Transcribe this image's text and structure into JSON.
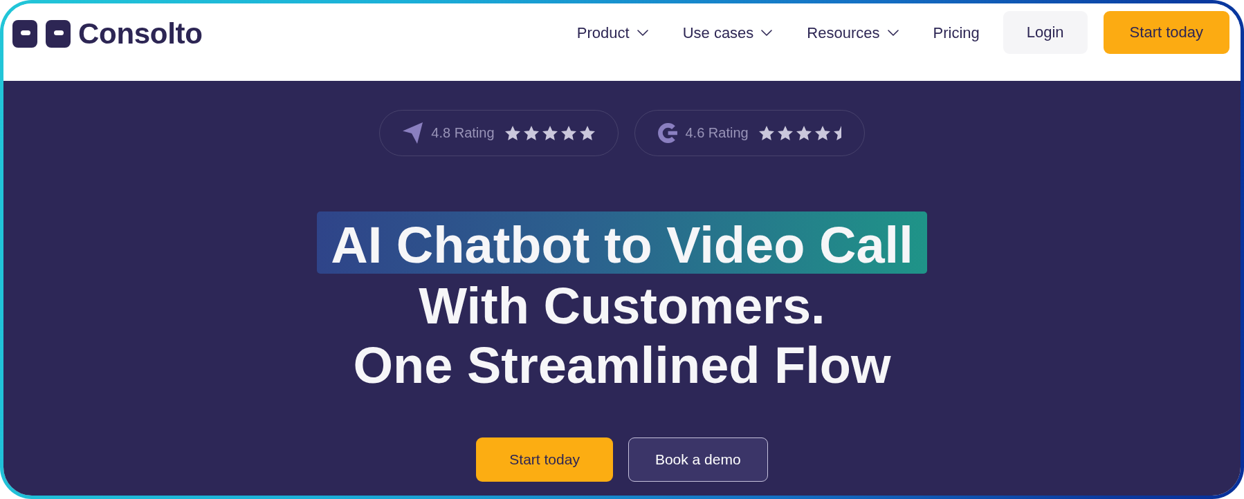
{
  "logo": {
    "name": "Consolto"
  },
  "nav": {
    "items": [
      {
        "label": "Product",
        "dropdown": true
      },
      {
        "label": "Use cases",
        "dropdown": true
      },
      {
        "label": "Resources",
        "dropdown": true
      },
      {
        "label": "Pricing",
        "dropdown": false
      }
    ],
    "buttons": [
      {
        "label": "Login",
        "kind": "secondary"
      },
      {
        "label": "Start today",
        "kind": "primary"
      }
    ]
  },
  "hero": {
    "ratings": [
      {
        "kind": "arrow",
        "label": "4.8 Rating",
        "stars": 5
      },
      {
        "kind": "ring",
        "label": "4.6 Rating",
        "stars": 4.5
      }
    ],
    "headline": {
      "highlight": "AI Chatbot to Video Call",
      "lines": [
        "With Customers.",
        "One Streamlined Flow"
      ]
    },
    "buttons": [
      {
        "label": "Start today",
        "kind": "primary"
      },
      {
        "label": "Book a demo",
        "kind": "secondary"
      }
    ]
  }
}
